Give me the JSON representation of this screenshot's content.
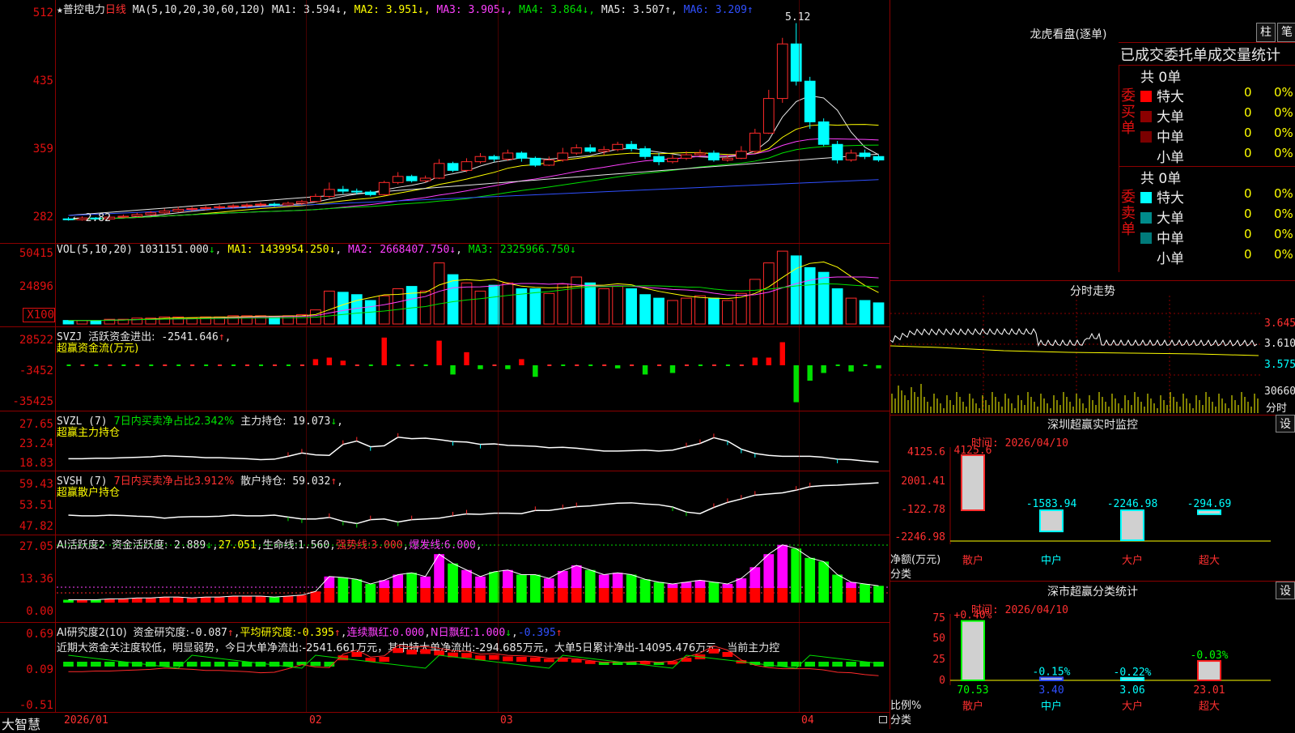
{
  "header": {
    "star": "★",
    "stock_name": "普控电力",
    "period": "日线",
    "ma_params": "MA(5,10,20,30,60,120)",
    "ma_items": [
      {
        "label": "MA1:",
        "value": "3.594",
        "arrow": "↓",
        "color": "#e8e8e8"
      },
      {
        "label": "MA2:",
        "value": "3.951",
        "arrow": "↓",
        "color": "#ffff00"
      },
      {
        "label": "MA3:",
        "value": "3.905",
        "arrow": "↓",
        "color": "#ff40ff"
      },
      {
        "label": "MA4:",
        "value": "3.864",
        "arrow": "↓",
        "color": "#00e000"
      },
      {
        "label": "MA5:",
        "value": "3.507",
        "arrow": "↑",
        "color": "#e8e8e8"
      },
      {
        "label": "MA6:",
        "value": "3.209",
        "arrow": "↑",
        "color": "#3050ff"
      }
    ]
  },
  "main": {
    "y_ticks": [
      "512",
      "435",
      "359",
      "282"
    ],
    "high_mark": "5.12",
    "low_mark": "2.82"
  },
  "vol": {
    "params": "VOL(5,10,20)",
    "value": "1031151.000",
    "ma1": "1439954.250",
    "ma2": "2668407.750",
    "ma3": "2325966.750",
    "y_ticks": [
      "50415",
      "24896"
    ],
    "unit": "X100"
  },
  "svzj": {
    "name": "SVZJ",
    "label": "活跃资金进出:",
    "value": "-2541.646",
    "sub": "超赢资金流(万元)",
    "y_ticks": [
      "28522",
      "-3452",
      "-35425"
    ]
  },
  "svzl": {
    "name": "SVZL (7)",
    "label": "7日内买卖净占比2.342%",
    "label2": "主力持仓:",
    "value": "19.073",
    "sub": "超赢主力持仓",
    "y_ticks": [
      "27.65",
      "23.24",
      "18.83"
    ]
  },
  "svsh": {
    "name": "SVSH (7)",
    "label": "7日内买卖净占比3.912%",
    "label2": "散户持仓:",
    "value": "59.032",
    "sub": "超赢散户持仓",
    "y_ticks": [
      "59.43",
      "53.51",
      "47.82"
    ]
  },
  "ai1": {
    "name": "AI活跃度2",
    "label": "资金活跃度:",
    "v1": "2.889",
    "v2": "27.051",
    "l3": "生命线:",
    "v3": "1.560",
    "l4": "强势线:",
    "v4": "3.000",
    "l5": "爆发线:",
    "v5": "6.000",
    "y_ticks": [
      "27.05",
      "13.36",
      "0.00"
    ]
  },
  "ai2": {
    "name": "AI研究度2(10)",
    "label": "资金研究度:",
    "v1": "-0.087",
    "l2": "平均研究度:",
    "v2": "-0.395",
    "l3": "连续飘红:",
    "v3": "0.000",
    "l4": "N日飘红:",
    "v4": "1.000",
    "v5": "-0.395",
    "commentary": "近期大资金关注度较低，明显弱势，今日大单净流出:-2541.661万元，其中特大单净流出:-294.685万元，大单5日累计净出-14095.476万元，当前主力控",
    "y_ticks": [
      "0.69",
      "0.09",
      "-0.51"
    ]
  },
  "xaxis": {
    "logo": "大智慧",
    "labels": [
      "2026/01",
      "02",
      "03",
      "04"
    ]
  },
  "lhb": {
    "title": "龙虎看盘(逐单)",
    "btn1": "柱",
    "btn2": "笔",
    "subtitle": "已成交委托单成交量统计",
    "buy": {
      "side": "委买单",
      "total": "共 0单",
      "rows": [
        {
          "n": "特大",
          "v": "0",
          "p": "0%",
          "c": "#ff0000"
        },
        {
          "n": "大单",
          "v": "0",
          "p": "0%",
          "c": "#8b0000"
        },
        {
          "n": "中单",
          "v": "0",
          "p": "0%",
          "c": "#7a0000"
        },
        {
          "n": "小单",
          "v": "0",
          "p": "0%",
          "c": ""
        }
      ]
    },
    "sell": {
      "side": "委卖单",
      "total": "共 0单",
      "rows": [
        {
          "n": "特大",
          "v": "0",
          "p": "0%",
          "c": "#00ffff"
        },
        {
          "n": "大单",
          "v": "0",
          "p": "0%",
          "c": "#008b8b"
        },
        {
          "n": "中单",
          "v": "0",
          "p": "0%",
          "c": "#007a7a"
        },
        {
          "n": "小单",
          "v": "0",
          "p": "0%",
          "c": ""
        }
      ]
    }
  },
  "fenshi": {
    "title": "分时走势",
    "ticks": [
      "3.645",
      "3.610",
      "3.575",
      "30660"
    ],
    "unit": "分时"
  },
  "sz_monitor": {
    "title": "深圳超赢实时监控",
    "btn": "设",
    "date": "时间: 2026/04/10",
    "y_ticks": [
      "4125.6",
      "2001.41",
      "-122.78",
      "-2246.98"
    ],
    "ylabel": "净额(万元)",
    "ylabel2": "分类",
    "bars": [
      {
        "cat": "散户",
        "value": "4125.6"
      },
      {
        "cat": "中户",
        "value": "-1583.94"
      },
      {
        "cat": "大户",
        "value": "-2246.98"
      },
      {
        "cat": "超大",
        "value": "-294.69"
      }
    ]
  },
  "sz_class": {
    "title": "深市超赢分类统计",
    "btn": "设",
    "date": "时间: 2026/04/10",
    "y_ticks": [
      "75",
      "50",
      "25",
      "0"
    ],
    "ylabel": "比例%",
    "ylabel2": "分类",
    "bars": [
      {
        "cat": "散户",
        "top": "+0.40%",
        "bottom": "70.53"
      },
      {
        "cat": "中户",
        "top": "-0.15%",
        "bottom": "3.40"
      },
      {
        "cat": "大户",
        "top": "-0.22%",
        "bottom": "3.06"
      },
      {
        "cat": "超大",
        "top": "-0.03%",
        "bottom": "23.01"
      }
    ]
  },
  "chart_data": {
    "type": "candlestick",
    "y_range": [
      2.82,
      5.12
    ],
    "candles": [
      [
        2.86,
        2.85,
        2.88,
        2.84
      ],
      [
        2.85,
        2.87,
        2.89,
        2.84
      ],
      [
        2.87,
        2.86,
        2.88,
        2.85
      ],
      [
        2.86,
        2.88,
        2.9,
        2.85
      ],
      [
        2.88,
        2.89,
        2.91,
        2.87
      ],
      [
        2.89,
        2.91,
        2.93,
        2.88
      ],
      [
        2.91,
        2.93,
        2.95,
        2.9
      ],
      [
        2.93,
        2.95,
        2.98,
        2.92
      ],
      [
        2.95,
        2.97,
        3.0,
        2.94
      ],
      [
        2.97,
        2.98,
        3.0,
        2.95
      ],
      [
        2.98,
        2.99,
        3.01,
        2.96
      ],
      [
        2.99,
        3.0,
        3.02,
        2.97
      ],
      [
        3.0,
        3.01,
        3.03,
        2.98
      ],
      [
        3.01,
        3.02,
        3.04,
        2.99
      ],
      [
        3.02,
        3.03,
        3.05,
        3.0
      ],
      [
        3.03,
        3.02,
        3.05,
        3.0
      ],
      [
        3.02,
        3.04,
        3.06,
        3.01
      ],
      [
        3.04,
        3.06,
        3.08,
        3.02
      ],
      [
        3.06,
        3.12,
        3.15,
        3.05
      ],
      [
        3.12,
        3.2,
        3.28,
        3.1
      ],
      [
        3.2,
        3.18,
        3.24,
        3.15
      ],
      [
        3.18,
        3.17,
        3.21,
        3.14
      ],
      [
        3.17,
        3.14,
        3.19,
        3.12
      ],
      [
        3.14,
        3.28,
        3.3,
        3.13
      ],
      [
        3.28,
        3.35,
        3.4,
        3.26
      ],
      [
        3.35,
        3.3,
        3.37,
        3.28
      ],
      [
        3.3,
        3.33,
        3.36,
        3.28
      ],
      [
        3.33,
        3.5,
        3.55,
        3.32
      ],
      [
        3.5,
        3.42,
        3.52,
        3.4
      ],
      [
        3.42,
        3.52,
        3.56,
        3.4
      ],
      [
        3.52,
        3.58,
        3.62,
        3.5
      ],
      [
        3.58,
        3.55,
        3.6,
        3.52
      ],
      [
        3.55,
        3.62,
        3.66,
        3.53
      ],
      [
        3.62,
        3.56,
        3.64,
        3.52
      ],
      [
        3.56,
        3.48,
        3.58,
        3.46
      ],
      [
        3.48,
        3.54,
        3.58,
        3.47
      ],
      [
        3.54,
        3.62,
        3.68,
        3.52
      ],
      [
        3.62,
        3.68,
        3.72,
        3.6
      ],
      [
        3.68,
        3.64,
        3.72,
        3.62
      ],
      [
        3.64,
        3.66,
        3.7,
        3.6
      ],
      [
        3.66,
        3.72,
        3.75,
        3.64
      ],
      [
        3.72,
        3.67,
        3.76,
        3.64
      ],
      [
        3.67,
        3.58,
        3.7,
        3.55
      ],
      [
        3.58,
        3.52,
        3.62,
        3.48
      ],
      [
        3.52,
        3.56,
        3.6,
        3.5
      ],
      [
        3.56,
        3.6,
        3.64,
        3.54
      ],
      [
        3.6,
        3.62,
        3.66,
        3.58
      ],
      [
        3.62,
        3.54,
        3.65,
        3.52
      ],
      [
        3.54,
        3.56,
        3.6,
        3.52
      ],
      [
        3.56,
        3.64,
        3.7,
        3.55
      ],
      [
        3.64,
        3.85,
        3.9,
        3.62
      ],
      [
        3.85,
        4.25,
        4.35,
        3.84
      ],
      [
        4.25,
        4.88,
        4.95,
        4.2
      ],
      [
        4.88,
        4.45,
        5.12,
        4.4
      ],
      [
        4.45,
        3.98,
        4.5,
        3.9
      ],
      [
        3.98,
        3.72,
        4.02,
        3.7
      ],
      [
        3.72,
        3.54,
        3.76,
        3.5
      ],
      [
        3.54,
        3.62,
        3.66,
        3.52
      ],
      [
        3.62,
        3.58,
        3.66,
        3.55
      ],
      [
        3.58,
        3.54,
        3.6,
        3.52
      ]
    ],
    "volume": [
      3,
      3,
      3,
      4,
      4,
      5,
      5,
      6,
      6,
      5,
      6,
      6,
      7,
      7,
      7,
      6,
      7,
      8,
      12,
      28,
      27,
      25,
      20,
      24,
      30,
      32,
      28,
      52,
      42,
      35,
      28,
      33,
      35,
      30,
      30,
      26,
      34,
      40,
      35,
      30,
      32,
      30,
      25,
      22,
      20,
      22,
      24,
      22,
      20,
      26,
      38,
      52,
      62,
      58,
      48,
      44,
      30,
      22,
      20,
      18
    ],
    "svzj": [
      0,
      0,
      0,
      0,
      0,
      0,
      0,
      0,
      0,
      0,
      0,
      0,
      0,
      0,
      0,
      0,
      0,
      0,
      8,
      10,
      6,
      0,
      0,
      36,
      0,
      0,
      0,
      32,
      -12,
      17,
      -5,
      0,
      -5,
      8,
      -15,
      0,
      0,
      0,
      0,
      0,
      -4,
      0,
      -12,
      0,
      -10,
      0,
      0,
      0,
      0,
      0,
      10,
      10,
      30,
      -48,
      -20,
      -10,
      0,
      -8,
      0,
      -4
    ],
    "svzl": [
      19.8,
      19.8,
      19.9,
      19.9,
      20.0,
      20.1,
      20.2,
      20.4,
      20.3,
      20.2,
      20.0,
      20.0,
      19.9,
      19.8,
      19.6,
      19.7,
      20.3,
      21.0,
      20.6,
      20.5,
      22.8,
      23.5,
      22.3,
      22.5,
      24.3,
      24.0,
      24.1,
      23.8,
      23.4,
      23.3,
      22.8,
      22.9,
      22.6,
      22.5,
      22.4,
      22.1,
      22.2,
      22.0,
      21.7,
      21.4,
      21.4,
      21.5,
      21.6,
      21.4,
      21.6,
      22.3,
      23.0,
      24.2,
      23.5,
      21.8,
      20.9,
      20.5,
      20.3,
      20.3,
      20.3,
      20.1,
      19.7,
      19.6,
      19.3,
      19.1
    ],
    "svsh": [
      50.8,
      50.6,
      50.6,
      50.8,
      50.7,
      50.5,
      50.4,
      50.0,
      50.3,
      50.4,
      50.4,
      50.5,
      50.8,
      50.6,
      50.6,
      50.8,
      50.3,
      49.8,
      49.8,
      50.2,
      49.2,
      48.6,
      49.6,
      49.8,
      49.0,
      49.6,
      49.8,
      50.0,
      50.6,
      51.1,
      51.0,
      51.3,
      51.3,
      51.2,
      52.0,
      52.0,
      52.5,
      53.0,
      53.2,
      53.6,
      53.9,
      54.0,
      53.7,
      53.5,
      52.9,
      51.6,
      51.2,
      52.8,
      54.1,
      55.0,
      56.0,
      56.3,
      56.6,
      57.3,
      58.2,
      58.5,
      58.6,
      58.8,
      59.0,
      59.2
    ]
  }
}
